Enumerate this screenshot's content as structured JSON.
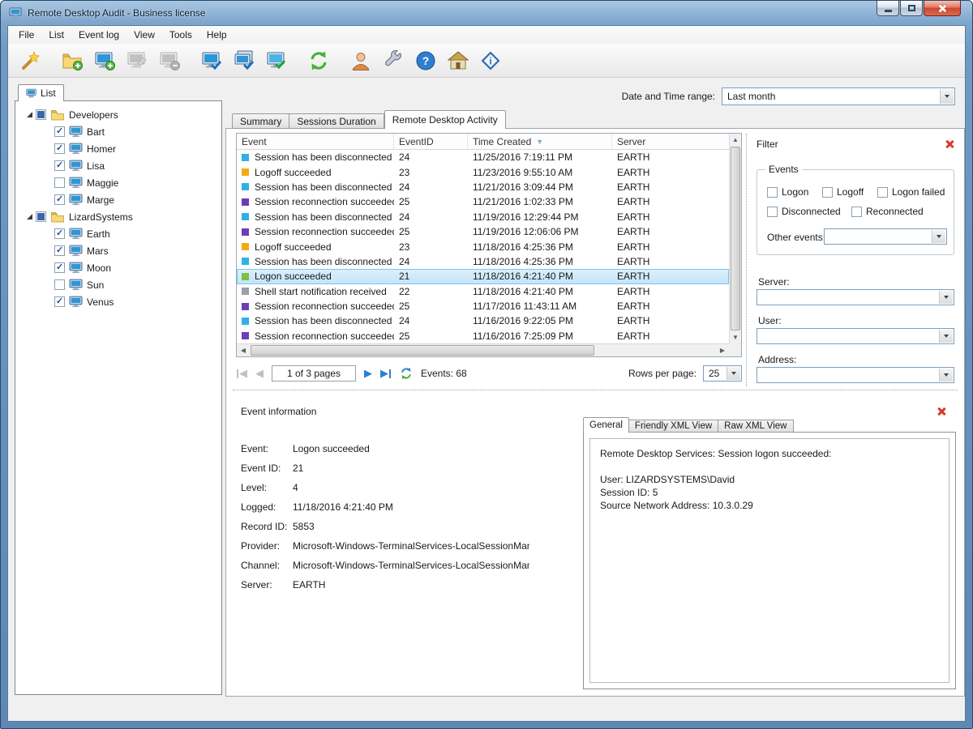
{
  "window": {
    "title": "Remote Desktop Audit - Business license"
  },
  "menu": {
    "items": [
      "File",
      "List",
      "Event log",
      "View",
      "Tools",
      "Help"
    ]
  },
  "toolbar": {
    "icons": [
      {
        "name": "wizard-icon",
        "enabled": true
      },
      {
        "name": "add-group-icon",
        "enabled": true
      },
      {
        "name": "add-computer-icon",
        "enabled": true
      },
      {
        "name": "edit-computer-icon",
        "enabled": false
      },
      {
        "name": "remove-computer-icon",
        "enabled": false
      },
      {
        "name": "check-computer-icon",
        "enabled": true
      },
      {
        "name": "check-computers-icon",
        "enabled": true
      },
      {
        "name": "check-all-computers-icon",
        "enabled": true
      },
      {
        "name": "refresh-icon",
        "enabled": true
      },
      {
        "name": "users-icon",
        "enabled": true
      },
      {
        "name": "settings-wrench-icon",
        "enabled": true
      },
      {
        "name": "help-icon",
        "enabled": true
      },
      {
        "name": "home-icon",
        "enabled": true
      },
      {
        "name": "about-info-icon",
        "enabled": true
      }
    ]
  },
  "left_panel": {
    "tab_label": "List",
    "groups": [
      {
        "label": "Developers",
        "state": "mixed",
        "children": [
          {
            "label": "Bart",
            "state": "checked"
          },
          {
            "label": "Homer",
            "state": "checked"
          },
          {
            "label": "Lisa",
            "state": "checked"
          },
          {
            "label": "Maggie",
            "state": "unchecked"
          },
          {
            "label": "Marge",
            "state": "checked"
          }
        ]
      },
      {
        "label": "LizardSystems",
        "state": "mixed",
        "children": [
          {
            "label": "Earth",
            "state": "checked"
          },
          {
            "label": "Mars",
            "state": "checked"
          },
          {
            "label": "Moon",
            "state": "checked"
          },
          {
            "label": "Sun",
            "state": "unchecked"
          },
          {
            "label": "Venus",
            "state": "checked"
          }
        ]
      }
    ]
  },
  "date_range": {
    "label": "Date and Time range:",
    "value": "Last month"
  },
  "main_tabs": {
    "summary": "Summary",
    "sessions": "Sessions Duration",
    "activity": "Remote Desktop Activity"
  },
  "event_table": {
    "columns": {
      "event": "Event",
      "event_id": "EventID",
      "time_created": "Time Created",
      "server": "Server"
    },
    "sorted_column": "Time Created",
    "rows": [
      {
        "color": "#2fb1e8",
        "event": "Session has been disconnected",
        "event_id": "24",
        "time": "11/25/2016 7:19:11 PM",
        "server": "EARTH"
      },
      {
        "color": "#f0ad12",
        "event": "Logoff succeeded",
        "event_id": "23",
        "time": "11/23/2016 9:55:10 AM",
        "server": "EARTH"
      },
      {
        "color": "#2fb1e8",
        "event": "Session has been disconnected",
        "event_id": "24",
        "time": "11/21/2016 3:09:44 PM",
        "server": "EARTH"
      },
      {
        "color": "#6a3fb5",
        "event": "Session reconnection succeeded",
        "event_id": "25",
        "time": "11/21/2016 1:02:33 PM",
        "server": "EARTH"
      },
      {
        "color": "#2fb1e8",
        "event": "Session has been disconnected",
        "event_id": "24",
        "time": "11/19/2016 12:29:44 PM",
        "server": "EARTH"
      },
      {
        "color": "#6a3fb5",
        "event": "Session reconnection succeeded",
        "event_id": "25",
        "time": "11/19/2016 12:06:06 PM",
        "server": "EARTH"
      },
      {
        "color": "#f0ad12",
        "event": "Logoff succeeded",
        "event_id": "23",
        "time": "11/18/2016 4:25:36 PM",
        "server": "EARTH"
      },
      {
        "color": "#2fb1e8",
        "event": "Session has been disconnected",
        "event_id": "24",
        "time": "11/18/2016 4:25:36 PM",
        "server": "EARTH"
      },
      {
        "color": "#7bc144",
        "event": "Logon succeeded",
        "event_id": "21",
        "time": "11/18/2016 4:21:40 PM",
        "server": "EARTH",
        "selected": true
      },
      {
        "color": "#9aa0a6",
        "event": "Shell start notification received",
        "event_id": "22",
        "time": "11/18/2016 4:21:40 PM",
        "server": "EARTH"
      },
      {
        "color": "#6a3fb5",
        "event": "Session reconnection succeeded",
        "event_id": "25",
        "time": "11/17/2016 11:43:11 AM",
        "server": "EARTH"
      },
      {
        "color": "#2fb1e8",
        "event": "Session has been disconnected",
        "event_id": "24",
        "time": "11/16/2016 9:22:05 PM",
        "server": "EARTH"
      },
      {
        "color": "#6a3fb5",
        "event": "Session reconnection succeeded",
        "event_id": "25",
        "time": "11/16/2016 7:25:09 PM",
        "server": "EARTH"
      }
    ]
  },
  "pagination": {
    "page_text": "1 of 3 pages",
    "events_count": "Events: 68",
    "rows_per_page_label": "Rows per page:",
    "rows_per_page_value": "25"
  },
  "filter": {
    "title": "Filter",
    "events_group_label": "Events",
    "checkboxes": [
      {
        "label": "Logon",
        "state": "unchecked"
      },
      {
        "label": "Logoff",
        "state": "unchecked"
      },
      {
        "label": "Logon failed",
        "state": "unchecked"
      },
      {
        "label": "Disconnected",
        "state": "unchecked"
      },
      {
        "label": "Reconnected",
        "state": "unchecked"
      }
    ],
    "other_events_label": "Other events:",
    "server_label": "Server:",
    "user_label": "User:",
    "address_label": "Address:"
  },
  "event_info": {
    "title": "Event information",
    "fields": [
      {
        "label": "Event:",
        "value": "Logon succeeded"
      },
      {
        "label": "Event ID:",
        "value": "21"
      },
      {
        "label": "Level:",
        "value": "4"
      },
      {
        "label": "Logged:",
        "value": "11/18/2016 4:21:40 PM"
      },
      {
        "label": "Record ID:",
        "value": "5853"
      },
      {
        "label": "Provider:",
        "value": "Microsoft-Windows-TerminalServices-LocalSessionManager"
      },
      {
        "label": "Channel:",
        "value": "Microsoft-Windows-TerminalServices-LocalSessionManager/Operationa"
      },
      {
        "label": "Server:",
        "value": "EARTH"
      }
    ],
    "tabs": {
      "general": "General",
      "friendly": "Friendly XML View",
      "raw": "Raw XML View"
    },
    "details": [
      "Remote Desktop Services: Session logon succeeded:",
      "",
      "User: LIZARDSYSTEMS\\David",
      "Session ID: 5",
      "Source Network Address: 10.3.0.29"
    ]
  }
}
